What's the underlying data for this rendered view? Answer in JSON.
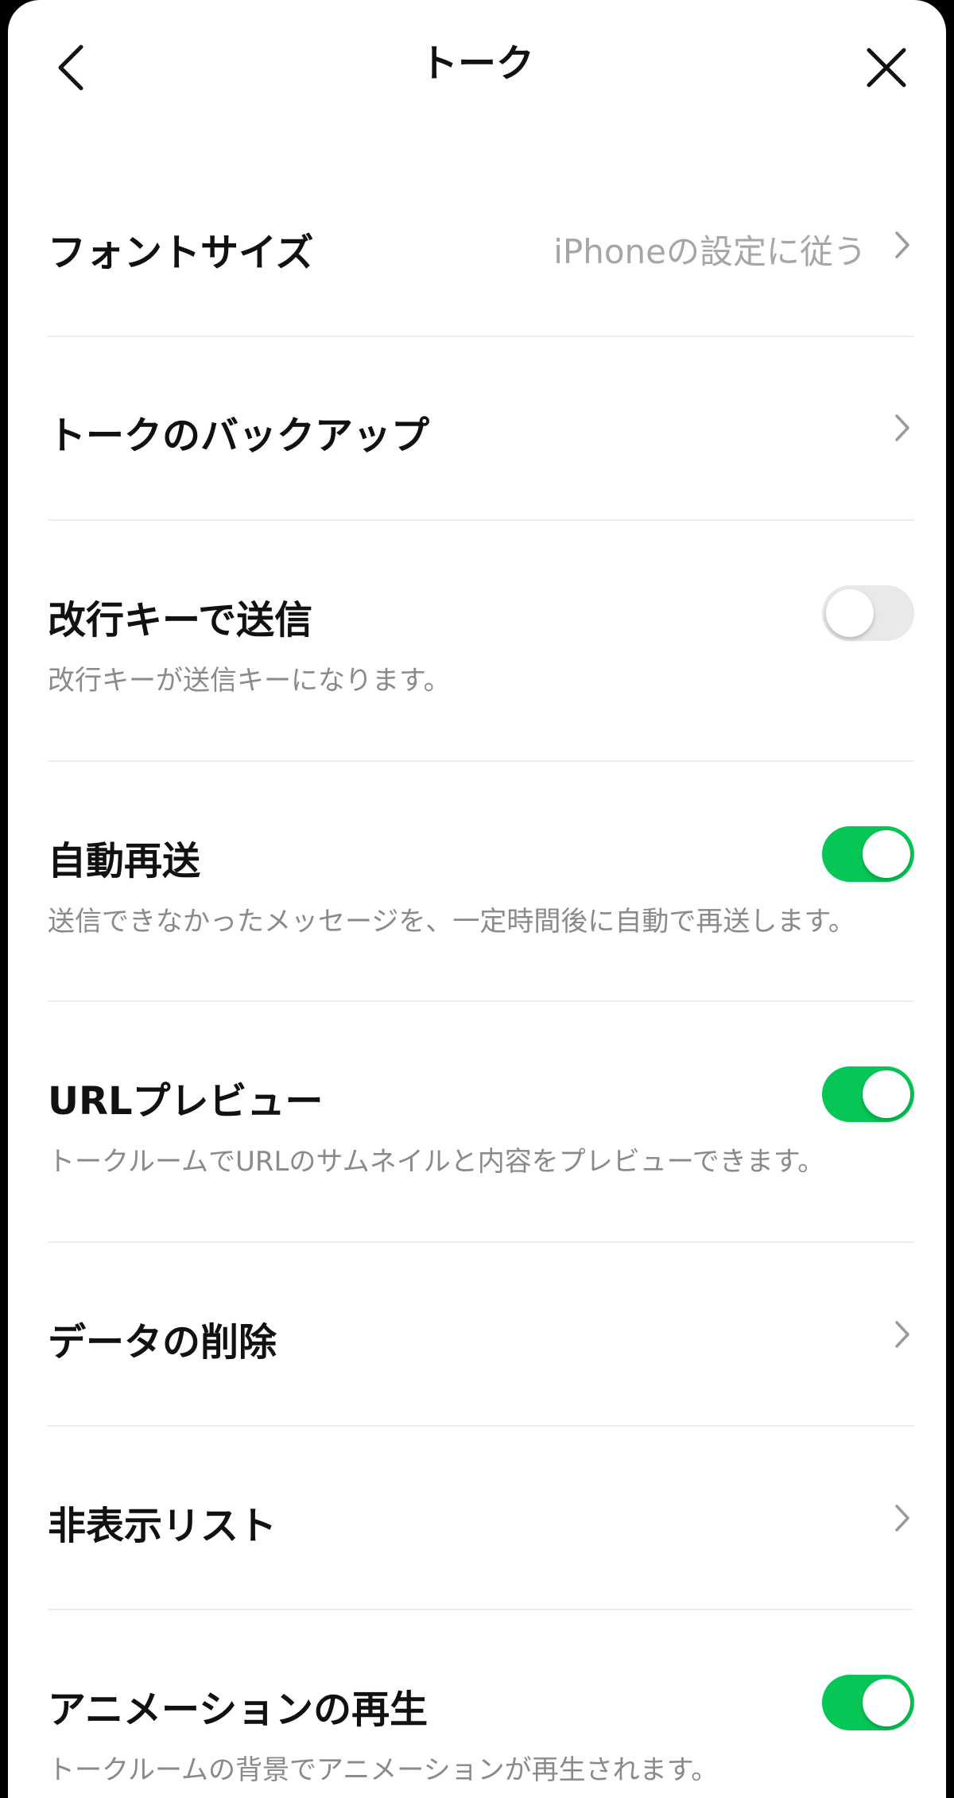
{
  "header": {
    "title": "トーク"
  },
  "icons": {
    "back": "chevron-left-icon",
    "close": "close-icon",
    "row_arrow": "chevron-right-icon"
  },
  "colors": {
    "toggle_on": "#06c755",
    "toggle_off": "#e9e9eb",
    "secondary_text": "#8a8a8a"
  },
  "settings": {
    "font_size": {
      "label": "フォントサイズ",
      "value": "iPhoneの設定に従う"
    },
    "backup": {
      "label": "トークのバックアップ"
    },
    "enter_to_send": {
      "label": "改行キーで送信",
      "description": "改行キーが送信キーになります。",
      "enabled": false
    },
    "auto_resend": {
      "label": "自動再送",
      "description": "送信できなかったメッセージを、一定時間後に自動で再送します。",
      "enabled": true
    },
    "url_preview": {
      "label": "URLプレビュー",
      "description": "トークルームでURLのサムネイルと内容をプレビューできます。",
      "enabled": true
    },
    "delete_data": {
      "label": "データの削除"
    },
    "hidden_list": {
      "label": "非表示リスト"
    },
    "animation": {
      "label": "アニメーションの再生",
      "description": "トークルームの背景でアニメーションが再生されます。",
      "enabled": true
    }
  }
}
